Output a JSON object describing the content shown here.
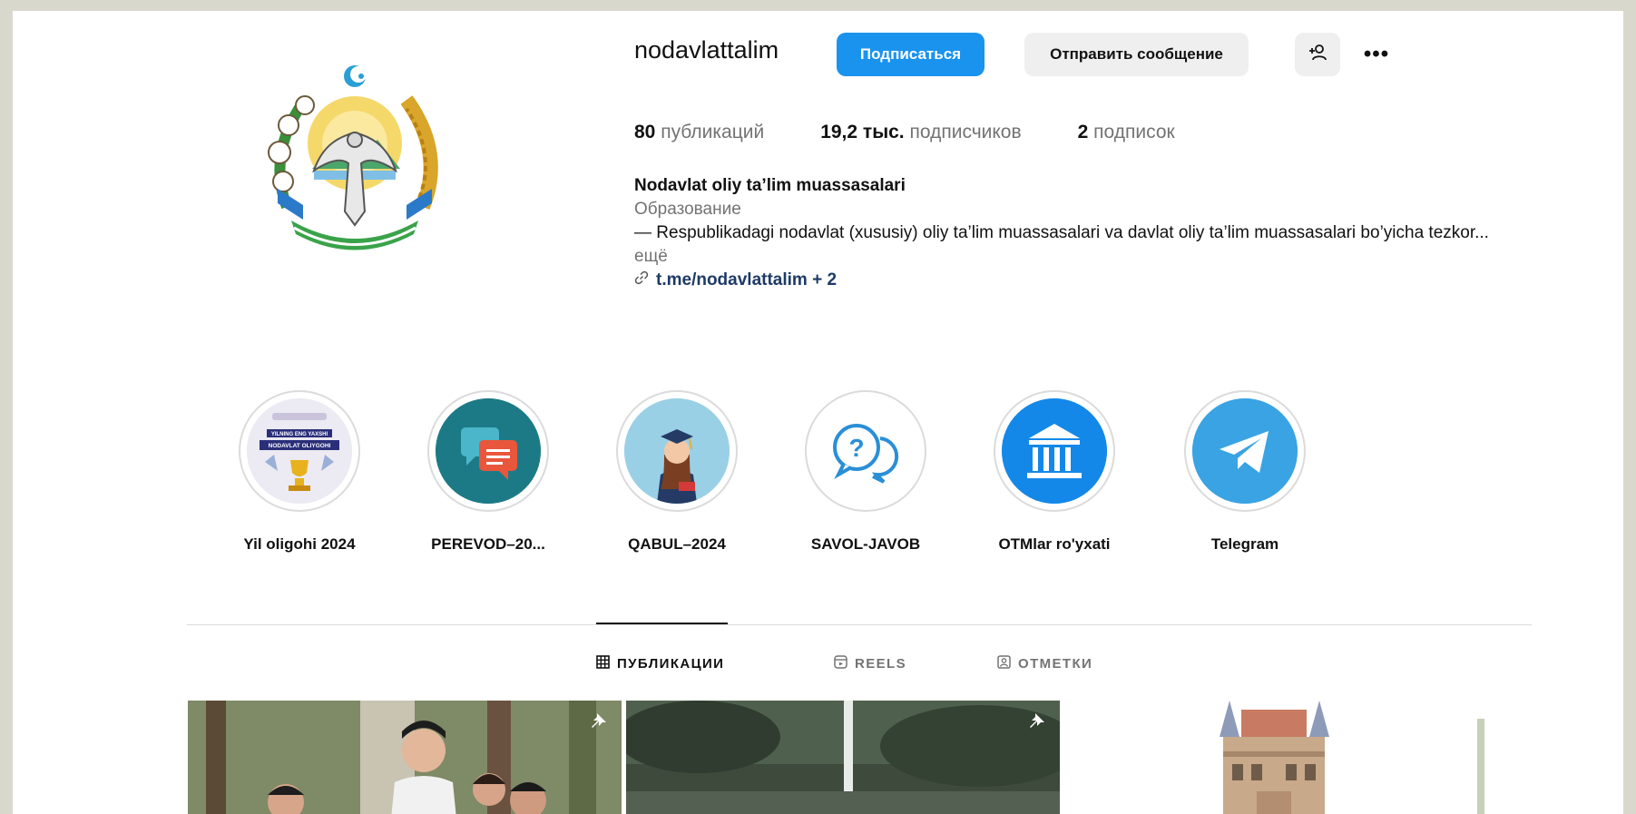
{
  "profile": {
    "username": "nodavlattalim",
    "follow_label": "Подписаться",
    "message_label": "Отправить сообщение",
    "add_user_icon": "add-user-icon",
    "more_label": "•••"
  },
  "stats": {
    "posts_count": "80",
    "posts_label": "публикаций",
    "followers_count": "19,2 тыс.",
    "followers_label": "подписчиков",
    "following_count": "2",
    "following_label": "подписок"
  },
  "bio": {
    "name": "Nodavlat oliy ta’lim muassasalari",
    "category": "Образование",
    "text": "— Respublikadagi nodavlat (xususiy) oliy ta’lim muassasalari va davlat oliy ta’lim muassasalari bo’yicha tezkor...",
    "more": "ещё",
    "link": "t.me/nodavlattalim + 2"
  },
  "highlights": [
    {
      "label": "Yil oligohi 2024",
      "badge_top": "YILNING ENG YAXSHI",
      "badge_main": "NODAVLAT OLIYGOHI"
    },
    {
      "label": "PEREVOD–20..."
    },
    {
      "label": "QABUL–2024"
    },
    {
      "label": "SAVOL-JAVOB"
    },
    {
      "label": "OTMlar ro'yxati"
    },
    {
      "label": "Telegram"
    }
  ],
  "tabs": [
    {
      "label": "ПУБЛИКАЦИИ",
      "icon": "grid-icon",
      "active": true
    },
    {
      "label": "REELS",
      "icon": "reels-icon",
      "active": false
    },
    {
      "label": "ОТМЕТКИ",
      "icon": "tagged-icon",
      "active": false
    }
  ],
  "colors": {
    "accent": "#1a93ee",
    "button_gray": "#efefef",
    "muted_text": "#737373",
    "backdrop": "#d9d8cc"
  }
}
